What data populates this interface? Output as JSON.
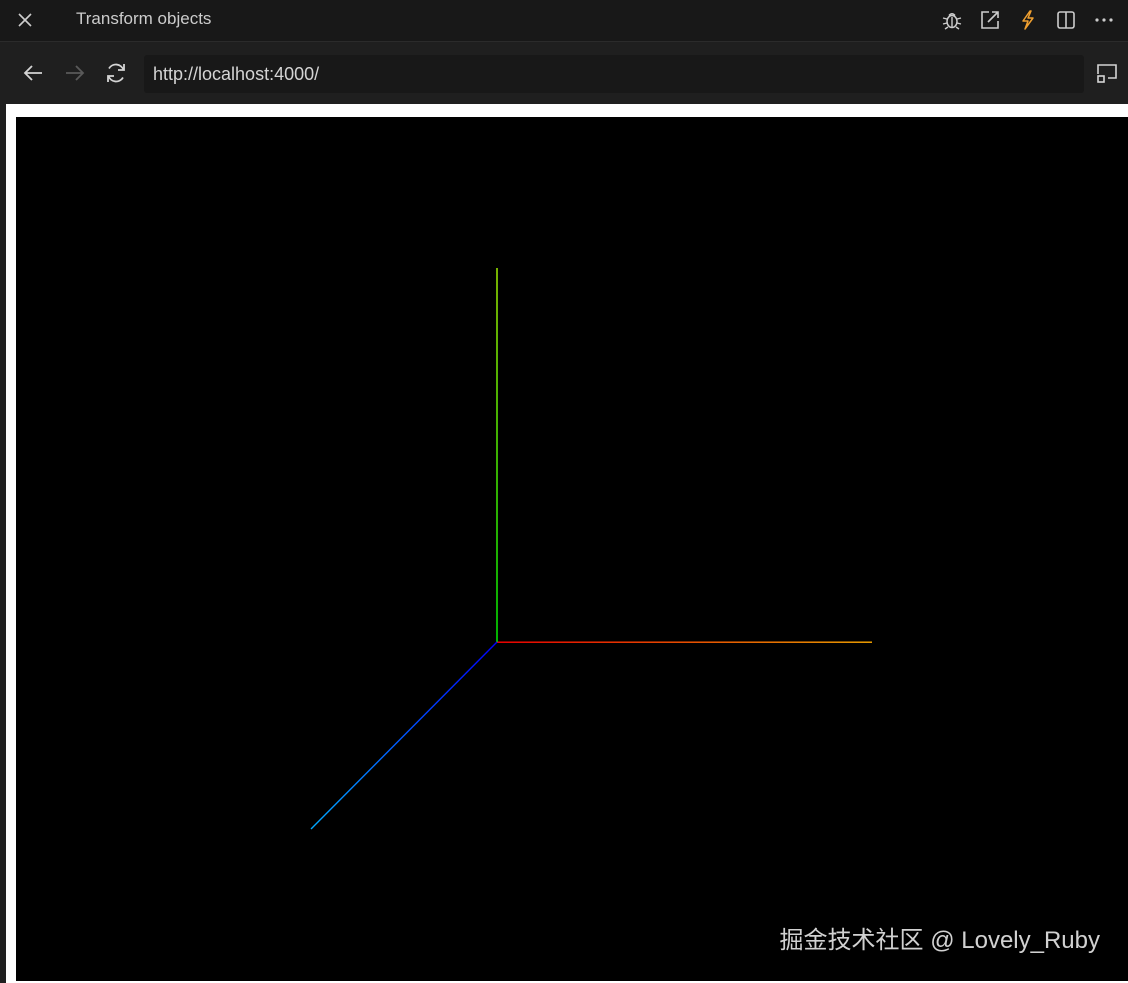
{
  "tab": {
    "title": "Transform objects",
    "close_icon": "close-icon",
    "actions": [
      "bug-icon",
      "open-external-icon",
      "lightning-icon",
      "split-editor-icon",
      "more-icon"
    ],
    "accent": "#f0a030"
  },
  "nav": {
    "back_icon": "arrow-left-icon",
    "forward_icon": "arrow-right-icon",
    "reload_icon": "refresh-icon",
    "url": "http://localhost:4000/",
    "screencast_icon": "screencast-icon"
  },
  "scene": {
    "description_type": "axes-helper",
    "axes": [
      {
        "name": "x",
        "color_start": "#ff0000",
        "color_end": "#ffaa00"
      },
      {
        "name": "y",
        "color_start": "#00ff00",
        "color_end": "#aaff00"
      },
      {
        "name": "z",
        "color_start": "#0000ff",
        "color_end": "#00aaff"
      }
    ]
  },
  "watermark": "掘金技术社区 @ Lovely_Ruby"
}
